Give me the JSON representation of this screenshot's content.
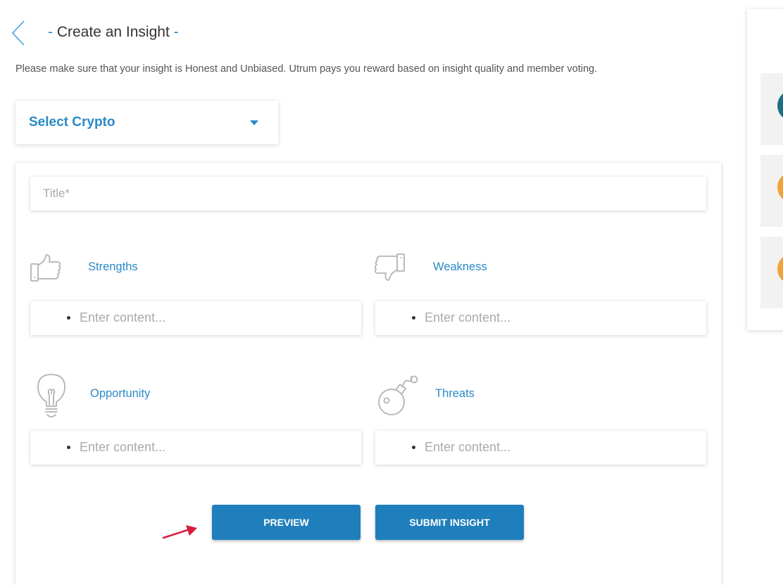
{
  "header": {
    "title_dash_left": "-",
    "title": "Create an Insight",
    "title_dash_right": "-",
    "subtitle": "Please make sure that your insight is Honest and Unbiased. Utrum pays you reward based on insight quality and member voting."
  },
  "select_crypto": {
    "label": "Select Crypto",
    "icon": "caret-down-icon"
  },
  "form": {
    "title_placeholder": "Title*",
    "sections": [
      {
        "label": "Strengths",
        "icon": "thumbs-up-icon",
        "placeholder": "Enter content..."
      },
      {
        "label": "Weakness",
        "icon": "thumbs-down-icon",
        "placeholder": "Enter content..."
      },
      {
        "label": "Opportunity",
        "icon": "lightbulb-icon",
        "placeholder": "Enter content..."
      },
      {
        "label": "Threats",
        "icon": "bomb-icon",
        "placeholder": "Enter content..."
      }
    ],
    "preview_label": "PREVIEW",
    "submit_label": "SUBMIT INSIGHT"
  },
  "colors": {
    "accent": "#2a8ac7",
    "button": "#1f7fbc",
    "arrow": "#d81b3f",
    "icon_gray": "#b3b3b3",
    "avatar_teal": "#1e6f86",
    "avatar_orange": "#f2a13b"
  }
}
